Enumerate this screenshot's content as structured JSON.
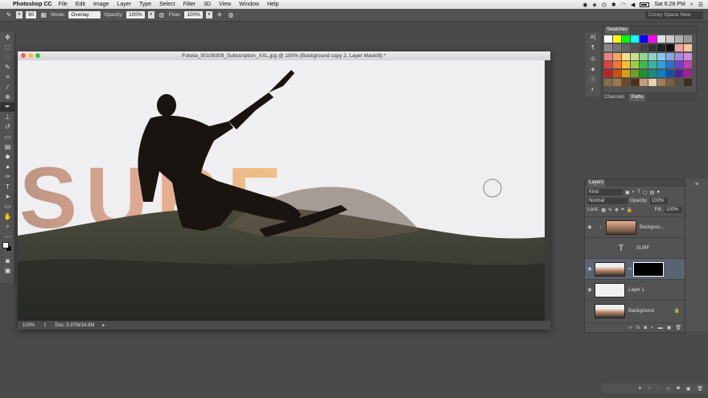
{
  "menubar": {
    "app": "Photoshop CC",
    "items": [
      "File",
      "Edit",
      "Image",
      "Layer",
      "Type",
      "Select",
      "Filter",
      "3D",
      "View",
      "Window",
      "Help"
    ],
    "clock": "Sat 6:28 PM"
  },
  "options": {
    "brush_size": "90",
    "mode_label": "Mode:",
    "mode_value": "Overlay",
    "opacity_label": "Opacity:",
    "opacity_value": "100%",
    "flow_label": "Flow:",
    "flow_value": "100%",
    "workspace": "Corey Space New"
  },
  "document": {
    "title": "Fotolia_50109309_Subscription_XXL.jpg @ 100% (Background copy 2, Layer Mask/8) *",
    "zoom": "100%",
    "doc_size": "Doc: 9.97M/34.8M",
    "artwork_text": "SURF"
  },
  "swatches": {
    "tab": "Swatches",
    "colors": [
      "#ffffff",
      "#ffff00",
      "#00ff00",
      "#00ffff",
      "#0000ff",
      "#ff00ff",
      "#e0e0e0",
      "#cccccc",
      "#b0b0b0",
      "#999999",
      "#8a8a8a",
      "#777777",
      "#666666",
      "#555555",
      "#444444",
      "#333333",
      "#222222",
      "#111111",
      "#f0a0a0",
      "#f6c79a",
      "#f08080",
      "#f4a460",
      "#f6dd88",
      "#c8e08a",
      "#96d494",
      "#8ad4c0",
      "#88c8e6",
      "#8aa6e2",
      "#a08ae0",
      "#d08ad8",
      "#e04040",
      "#f07830",
      "#f4c030",
      "#9ccc40",
      "#40b850",
      "#30b8a0",
      "#30a0d8",
      "#3070d0",
      "#7040c8",
      "#c040b0",
      "#c02020",
      "#d05010",
      "#d8a010",
      "#70a020",
      "#209030",
      "#109080",
      "#1080b8",
      "#1050a8",
      "#5020a0",
      "#a02090",
      "#8a6a4a",
      "#a07850",
      "#6a4a2a",
      "#503010",
      "#c0a080",
      "#e8d0b0",
      "#9a8060",
      "#786040",
      "#585040",
      "#383020"
    ]
  },
  "channels_paths": {
    "tabs": [
      "Channels",
      "Paths"
    ]
  },
  "layers": {
    "tab": "Layers",
    "filter": "Kind",
    "blend": "Normal",
    "opacity_label": "Opacity:",
    "opacity_value": "100%",
    "lock_label": "Lock:",
    "fill_label": "Fill:",
    "fill_value": "100%",
    "items": [
      {
        "name": "Backgrou..."
      },
      {
        "name": "SURF"
      },
      {
        "name": ""
      },
      {
        "name": "Layer 1"
      },
      {
        "name": "Background"
      }
    ]
  },
  "colors": {
    "ui_panel": "#535353",
    "selection": "#5b6372",
    "sky": "#efeef0",
    "text_fill_top": "#b98c7c",
    "text_fill_bottom": "#f2c07c"
  }
}
